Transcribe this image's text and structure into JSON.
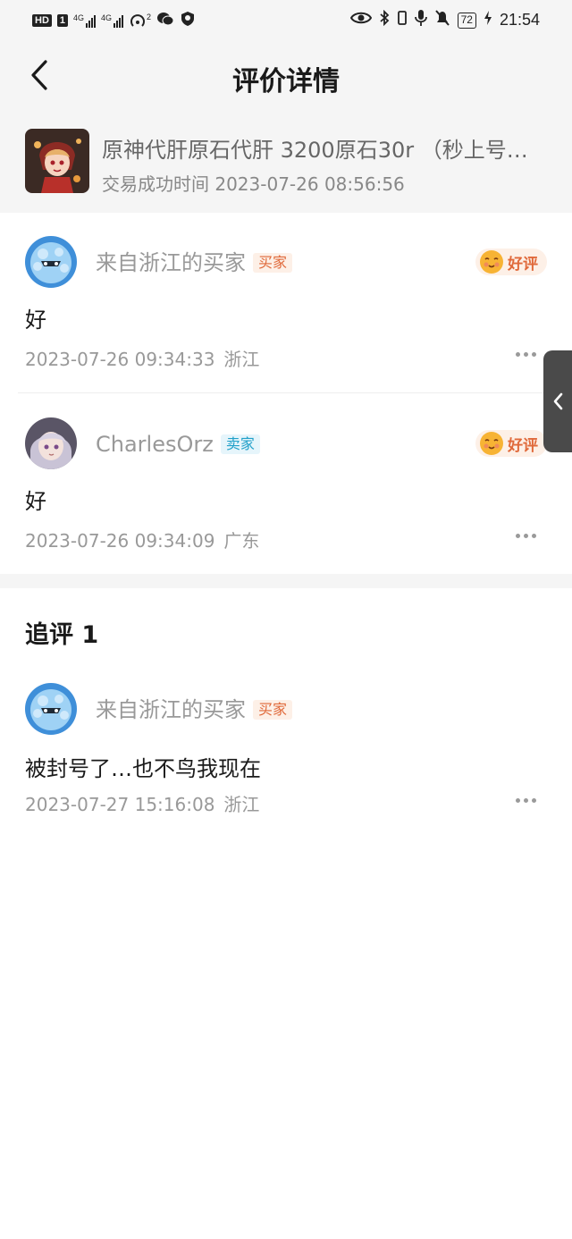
{
  "status_bar": {
    "left_badge": "HD",
    "left_sim": "1",
    "net1": "4G",
    "net2": "4G",
    "hotspot_count": "2",
    "battery": "72",
    "time": "21:54"
  },
  "header": {
    "title": "评价详情"
  },
  "product": {
    "title": "原神代肝原石代肝 3200原石30r （秒上号…",
    "trade_time_label": "交易成功时间",
    "trade_time": "2023-07-26 08:56:56"
  },
  "reviews": [
    {
      "name": "来自浙江的买家",
      "role": "买家",
      "rating": "好评",
      "content": "好",
      "time": "2023-07-26 09:34:33",
      "region": "浙江"
    },
    {
      "name": "CharlesOrz",
      "role": "卖家",
      "rating": "好评",
      "content": "好",
      "time": "2023-07-26 09:34:09",
      "region": "广东"
    }
  ],
  "followup": {
    "title": "追评 1",
    "name": "来自浙江的买家",
    "role": "买家",
    "content": "被封号了…也不鸟我现在",
    "time": "2023-07-27 15:16:08",
    "region": "浙江"
  },
  "colors": {
    "accent_orange": "#e0693a",
    "accent_blue": "#21a0c9",
    "background_gray": "#f5f5f5"
  }
}
